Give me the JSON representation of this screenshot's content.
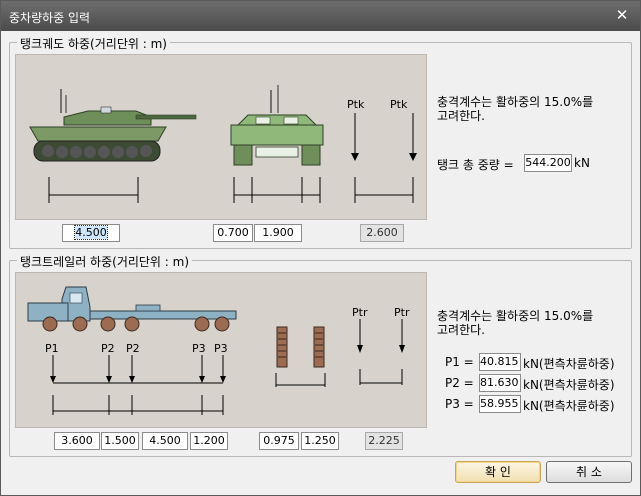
{
  "window": {
    "title": "중차량하중 입력",
    "close_glyph": "✕"
  },
  "tank": {
    "group_title": "탱크궤도 하중(거리단위 : m)",
    "load_label_left": "Ptk",
    "load_label_right": "Ptk",
    "note_line1": "충격계수는 활하중의 15.0%를",
    "note_line2": "고려한다.",
    "weight_label": "탱크 총 중량 =",
    "weight_value": "544.200",
    "weight_unit": "kN",
    "length_value": "4.500",
    "track_width_value": "0.700",
    "track_gap_value": "1.900",
    "load_spacing_value": "2.600"
  },
  "trailer": {
    "group_title": "탱크트레일러 하중(거리단위 : m)",
    "axle_labels": [
      "P1",
      "P2",
      "P2",
      "P3",
      "P3"
    ],
    "load_label_left": "Ptr",
    "load_label_right": "Ptr",
    "note_line1": "충격계수는 활하중의 15.0%를",
    "note_line2": "고려한다.",
    "loads": [
      {
        "label": "P1 =",
        "value": "40.815",
        "unit": "kN(편측차륜하중)"
      },
      {
        "label": "P2 =",
        "value": "81.630",
        "unit": "kN(편측차륜하중)"
      },
      {
        "label": "P3 =",
        "value": "58.955",
        "unit": "kN(편측차륜하중)"
      }
    ],
    "spacings": [
      "3.600",
      "1.500",
      "4.500",
      "1.200"
    ],
    "wheel_width_value": "0.975",
    "wheel_gap_value": "1.250",
    "load_spacing_value": "2.225"
  },
  "buttons": {
    "ok_label": "확 인",
    "cancel_label": "취 소"
  },
  "colors": {
    "panel_bg": "#d7d3cc",
    "tank_green": "#6f8f5a",
    "trailer_blue": "#8fb1c4",
    "wheel_brown": "#9b6b52"
  }
}
